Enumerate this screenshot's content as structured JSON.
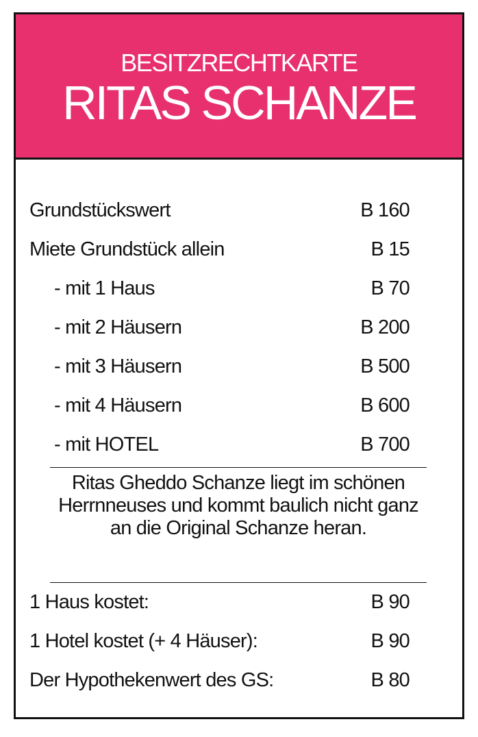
{
  "colors": {
    "header_bg": "#e8306f",
    "border": "#111111",
    "text": "#111111",
    "header_text": "#ffffff"
  },
  "header": {
    "kicker": "BESITZRECHTKARTE",
    "title": "RITAS SCHANZE"
  },
  "rent_rows": [
    {
      "label": "Grundstückswert",
      "value": "B 160"
    },
    {
      "label": "Miete Grundstück allein",
      "value": "B 15"
    },
    {
      "label": "- mit 1 Haus",
      "value": "B 70"
    },
    {
      "label": "- mit 2 Häusern",
      "value": "B 200"
    },
    {
      "label": "- mit 3 Häusern",
      "value": "B 500"
    },
    {
      "label": "- mit 4 Häusern",
      "value": "B 600"
    },
    {
      "label": "- mit HOTEL",
      "value": "B 700"
    }
  ],
  "description": "Ritas Gheddo Schanze liegt im schönen Herrnneuses und kommt baulich nicht ganz an die Original Schanze heran.",
  "cost_rows": [
    {
      "label": "1 Haus kostet:",
      "value": "B 90"
    },
    {
      "label": "1 Hotel kostet (+ 4 Häuser):",
      "value": "B 90"
    },
    {
      "label": "Der Hypothekenwert des GS:",
      "value": "B 80"
    }
  ]
}
